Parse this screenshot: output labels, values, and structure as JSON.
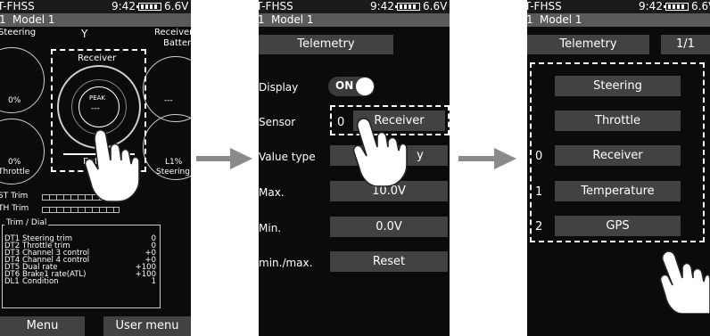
{
  "status": {
    "system": "T-FHSS",
    "time": "9:42",
    "voltage": "6.6V",
    "model_number": "1",
    "model_name": "Model 1"
  },
  "home": {
    "labels": {
      "steering": "Steering",
      "receiver_battery_1": "Receiver",
      "receiver_battery_2": "Battery",
      "receiver": "Receiver",
      "peak": "PEAK",
      "peak_value": "---",
      "throttle": "Throttle",
      "battery": "Battery",
      "left_gauge_value": "0%",
      "right_gauge_value": "---",
      "throttle_value": "0%",
      "steering_value": "L1%",
      "antenna_icon": "Y"
    },
    "trims": [
      {
        "label": "ST Trim"
      },
      {
        "label": "TH Trim"
      }
    ],
    "trim_dial_title": "Trim / Dial",
    "dials": [
      {
        "id": "DT1",
        "name": "Steering trim",
        "value": "0"
      },
      {
        "id": "DT2",
        "name": "Throttle trim",
        "value": "0"
      },
      {
        "id": "DT3",
        "name": "Channel 3 control",
        "value": "+0"
      },
      {
        "id": "DT4",
        "name": "Channel 4 control",
        "value": "+0"
      },
      {
        "id": "DT5",
        "name": "Dual rate",
        "value": "+100"
      },
      {
        "id": "DT6",
        "name": "Brake1 rate(ATL)",
        "value": "+100"
      },
      {
        "id": "DL1",
        "name": "Condition",
        "value": "1"
      }
    ],
    "menu_button": "Menu",
    "user_menu_button": "User menu"
  },
  "telemetry_setup": {
    "title": "Telemetry",
    "display_label": "Display",
    "display_toggle": "ON",
    "sensor_label": "Sensor",
    "sensor_slot": "0",
    "sensor_value": "Receiver",
    "value_type_label": "Value type",
    "value_type_value": "y",
    "max_label": "Max.",
    "max_value": "10.0V",
    "min_label": "Min.",
    "min_value": "0.0V",
    "minmax_label": "min./max.",
    "reset_button": "Reset"
  },
  "sensor_select": {
    "title": "Telemetry",
    "page": "1/1",
    "options": [
      {
        "slot": "",
        "label": "Steering"
      },
      {
        "slot": "",
        "label": "Throttle"
      },
      {
        "slot": "0",
        "label": "Receiver"
      },
      {
        "slot": "1",
        "label": "Temperature"
      },
      {
        "slot": "2",
        "label": "GPS"
      }
    ]
  },
  "colors": {
    "screen_bg": "#0b0b0b",
    "button_bg": "#424242",
    "header_bar": "#5a5a5a",
    "arrow": "#8a8a8a"
  }
}
